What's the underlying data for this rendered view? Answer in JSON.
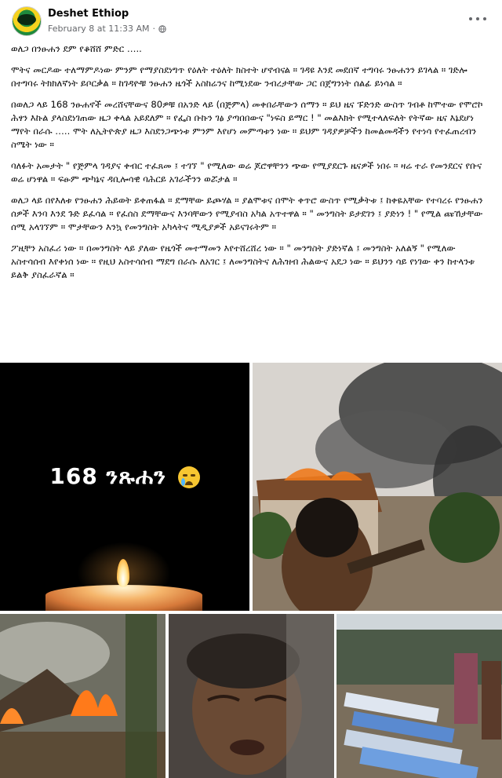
{
  "post": {
    "page_name": "Deshet Ethiop",
    "timestamp": "February 8 at 11:33 AM",
    "visibility_icon": "globe-icon",
    "more_icon": "more-options-icon",
    "paragraphs": [
      "ወለጋ በንፁሐን ደም የቆሸሸ ምድር …..",
      "ሞትና መርዶው ተለማምዶነው ምንም የማያስደነግጥ የዕለት ተዕለት ክስተት ሆኖብናል ። ገዳዩ እንደ መደበኛ ተግባሩ ንፁሐንን ይገላል ። ገድሎ በተግባሩ ትክክለኛነት ይቦርቃል ። ከገዳዮቹ ንፁሐን ዜጎች አስከሬንና ከሚነደው ንብረታቸው ጋር በጀግንነት ሰልፊ ይነሳል ።",
      "በወለጋ ላይ 168 ንፁሐኖች መረሸናቸውና 80ዎቹ በአንድ ላይ (በጅምላ) መቀበራቸውን ሰማን ። ይህ ዜና ፑድንድ ውስጥ ገብቶ ከሞተው የሞሮኮ ሕፃን እኩል ያላስደነገጠው ዜጋ ቀላል አይደለም ። የፌስ ቡኩን ገፅ ያጣበበውና \"ነፍስ ይማር ! \" መልእክት የሚተላለፍለት የትኛው ዜና እኔደሆነ ማየት በራሱ ….. ሞት ለኢትዮጵያ ዜጋ እስደንጋጭነቱ ምንም እየሆነ መምጣቱን ነው ። ይህም ገዳያዎቻችን ከመልመዳችን የተነሳ የተፈጠረብን ስሜት ነው ።",
      "ባለፉት አመታት \" የጅምላ ገዳያና ቀብር ተፈጸመ ፤ ተገኘ \" የሚለው ወሬ ጆሮዋቸንን ጭው የሚያደርጉ ዜናዎች ነበሩ ። ዛሬ ተራ የመንደርና የቡና ወሬ ሆነዋል ። ፍፁም ጭካኔና ዳቢሎሳዊ ባሕርይ አገራችንን ወሯታል ።",
      "ወለጋ ላይ በየእለቱ የንፁሐን ሕይወት ይቀጠፋል ። ደማቸው ይጮሃል ። ያልሞቱና በሞት ቀጥሮ ውስጥ የሚቃትቱ ፤ ከቀዬአቸው የተባረሩ የንፁሐን ሰዎች እንባ እንደ ጉድ ይፈሳል ። የፈሰስ ደማቸውና እንባቸውን የሚያብስ አካል አጥተዋል ። \" መንግስት ይታደገን ፤ ያድነን ! \" የሚል ጩኸታቸው ሰሚ አላገኘም ። ሞታቸውን እንኳ የመንግስት አካላትና ሚዲያዎች አይናገሩትም ።",
      "ፖዚቸን አስፈሪ ነው ። በመንግስት ላይ ያለው የዜጎች መተማመን እየተሸረሸረ ነው ። \" መንግስት ያድነኛል ፤ መንግስት አለልኝ \" የሚለው አስተሳሰብ እየቀነሰ ነው ። የዚህ አስተሳሰብ ማደግ በራሱ ለአገር ፤ ለመንግስትና ለሕዝብ ሕልውና አደጋ ነው ። ይህንን ሳይ የነገው ቀን ከተላንቱ ይልቅ ያስፈራኛል ።"
    ]
  },
  "images": {
    "memorial_text": "168 ንጹሐን",
    "memorial_emoji": "crying-face-emoji",
    "candle_icon": "candle-icon"
  }
}
